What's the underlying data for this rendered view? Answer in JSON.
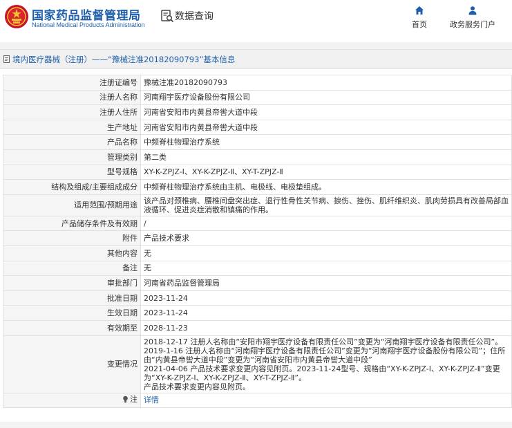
{
  "header": {
    "brand_cn": "国家药品监督管理局",
    "brand_en": "National Medical Products Administration",
    "query_label": "数据查询",
    "nav_home": "首页",
    "nav_user": "政务服务门户",
    "accent_color": "#1f5faa"
  },
  "breadcrumb": "境内医疗器械（注册）——“豫械注准20182090793”基本信息",
  "rows": [
    {
      "label": "注册证编号",
      "value": "豫械注准20182090793"
    },
    {
      "label": "注册人名称",
      "value": "河南翔宇医疗设备股份有限公司"
    },
    {
      "label": "注册人住所",
      "value": "河南省安阳市内黄县帝喾大道中段"
    },
    {
      "label": "生产地址",
      "value": "河南省安阳市内黄县帝喾大道中段"
    },
    {
      "label": "产品名称",
      "value": "中频脊柱物理治疗系统"
    },
    {
      "label": "管理类别",
      "value": "第二类"
    },
    {
      "label": "型号规格",
      "value": "XY-K-ZPJZ-Ⅰ、XY-K-ZPJZ-Ⅱ、XY-T-ZPJZ-Ⅱ"
    },
    {
      "label": "结构及组成/主要组成成分",
      "value": "中频脊柱物理治疗系统由主机、电极线、电极垫组成。"
    },
    {
      "label": "适用范围/预期用途",
      "value": "该产品对颈椎病、腰椎间盘突出症、退行性骨性关节病、捩伤、挫伤、肌纤维织炎、肌肉劳损具有改善局部血液循环、促进炎症消散和镇痛的作用。"
    },
    {
      "label": "产品储存条件及有效期",
      "value": "/"
    },
    {
      "label": "附件",
      "value": "产品技术要求"
    },
    {
      "label": "其他内容",
      "value": "无"
    },
    {
      "label": "备注",
      "value": "无"
    },
    {
      "label": "审批部门",
      "value": "河南省药品监督管理局"
    },
    {
      "label": "批准日期",
      "value": "2023-11-24"
    },
    {
      "label": "生效日期",
      "value": "2023-11-24"
    },
    {
      "label": "有效期至",
      "value": "2028-11-23"
    }
  ],
  "change": {
    "label": "变更情况",
    "lines": [
      "2018-12-17 注册人名称由“安阳市翔宇医疗设备有限责任公司”变更为“河南翔宇医疗设备有限责任公司”。",
      "2019-1-16 注册人名称由“河南翔宇医疗设备有限责任公司”变更为“河南翔宇医疗设备股份有限公司”；住所由“内黄县帝喾大道中段”变更为“河南省安阳市内黄县帝喾大道中段”",
      "2021-04-06 产品技术要求变更内容见附页。2023-11-24型号、规格由“XY-K-ZPJZ-Ⅰ、XY-K-ZPJZ-Ⅱ”变更为“XY-K-ZPJZ-Ⅰ、XY-K-ZPJZ-Ⅱ、XY-T-ZPJZ-Ⅱ”。",
      "产品技术要求变更内容见附页。"
    ]
  },
  "note": {
    "label": "注",
    "link": "详情",
    "icon": "bulb-icon"
  }
}
